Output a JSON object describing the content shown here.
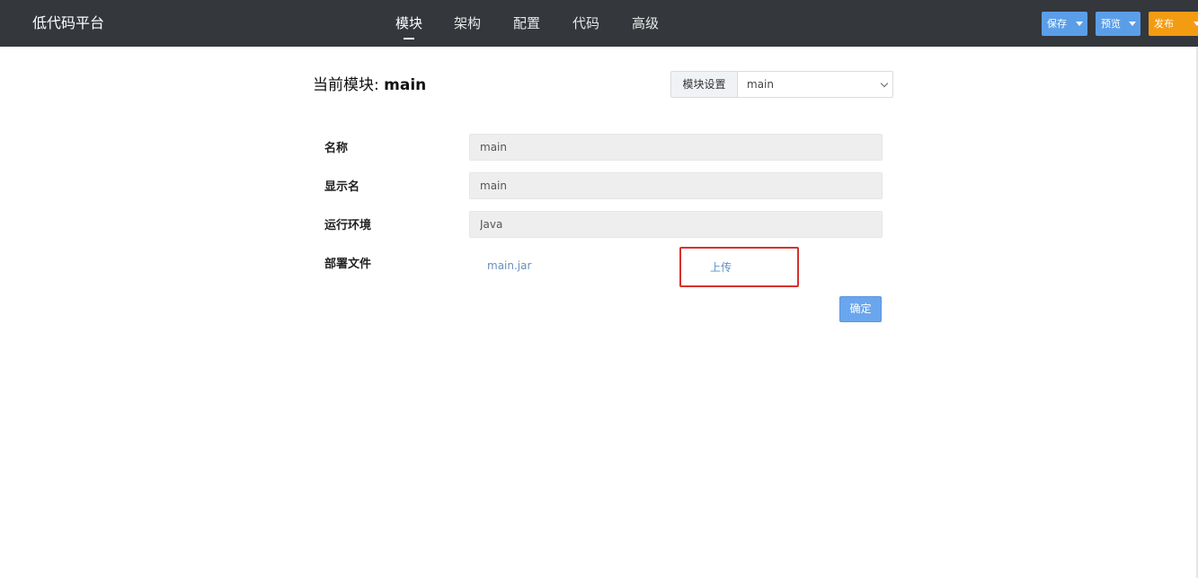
{
  "app": {
    "brand": "低代码平台"
  },
  "nav": {
    "items": [
      {
        "label": "模块",
        "active": true
      },
      {
        "label": "架构",
        "active": false
      },
      {
        "label": "配置",
        "active": false
      },
      {
        "label": "代码",
        "active": false
      },
      {
        "label": "高级",
        "active": false
      }
    ]
  },
  "toolbar": {
    "save_label": "保存",
    "preview_label": "预览",
    "publish_label": "发布"
  },
  "header": {
    "title_prefix": "当前模块: ",
    "title_module": "main",
    "settings_label": "模块设置",
    "module_select_value": "main"
  },
  "form": {
    "name_label": "名称",
    "name_value": "main",
    "display_label": "显示名",
    "display_value": "main",
    "runtime_label": "运行环境",
    "runtime_value": "Java",
    "deploy_label": "部署文件",
    "deploy_file": "main.jar",
    "upload_label": "上传",
    "confirm_label": "确定"
  },
  "colors": {
    "topbar": "#34373c",
    "primary": "#5b9ee8",
    "publish": "#f39c12",
    "highlight_border": "#d9302c"
  }
}
